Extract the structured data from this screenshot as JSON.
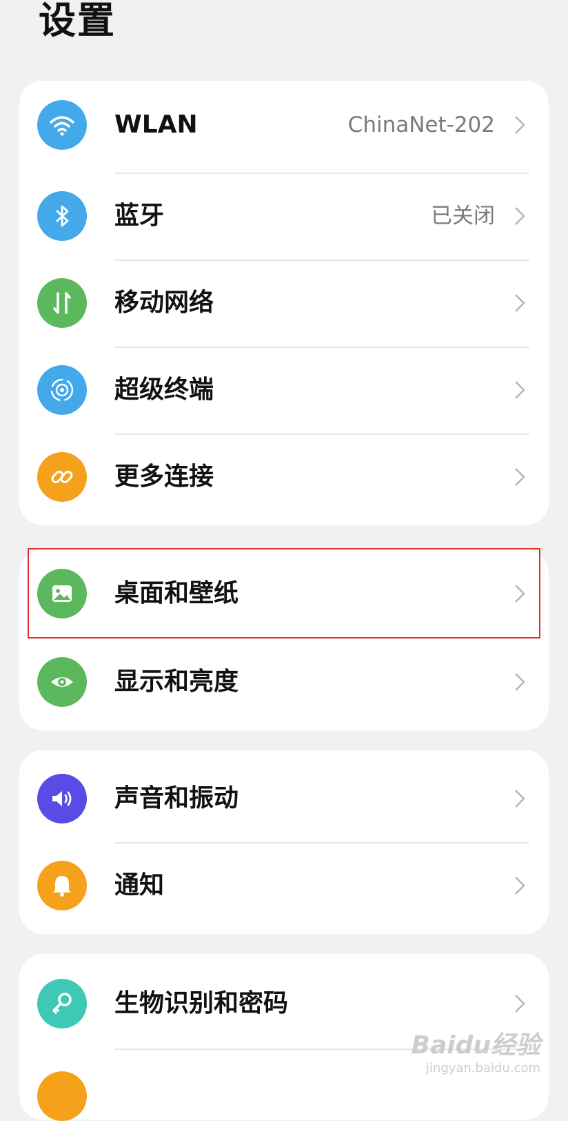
{
  "title": "设置",
  "groups": [
    {
      "items": [
        {
          "label": "WLAN",
          "value": "ChinaNet-202",
          "icon": "wifi-icon",
          "color": "#43a9ea"
        },
        {
          "label": "蓝牙",
          "value": "已关闭",
          "icon": "bluetooth-icon",
          "color": "#43a9ea"
        },
        {
          "label": "移动网络",
          "value": "",
          "icon": "mobile-network-icon",
          "color": "#5cb85c"
        },
        {
          "label": "超级终端",
          "value": "",
          "icon": "super-device-icon",
          "color": "#43a9ea"
        },
        {
          "label": "更多连接",
          "value": "",
          "icon": "link-icon",
          "color": "#f5a11c"
        }
      ]
    },
    {
      "items": [
        {
          "label": "桌面和壁纸",
          "value": "",
          "icon": "wallpaper-icon",
          "color": "#5cb85c",
          "highlighted": true
        },
        {
          "label": "显示和亮度",
          "value": "",
          "icon": "eye-icon",
          "color": "#5cb85c"
        }
      ]
    },
    {
      "items": [
        {
          "label": "声音和振动",
          "value": "",
          "icon": "sound-icon",
          "color": "#5a4be6"
        },
        {
          "label": "通知",
          "value": "",
          "icon": "bell-icon",
          "color": "#f5a11c"
        }
      ]
    },
    {
      "items": [
        {
          "label": "生物识别和密码",
          "value": "",
          "icon": "key-icon",
          "color": "#3ec9b6"
        }
      ]
    }
  ],
  "watermark": {
    "logo": "Baidu经验",
    "url": "jingyan.baidu.com"
  }
}
